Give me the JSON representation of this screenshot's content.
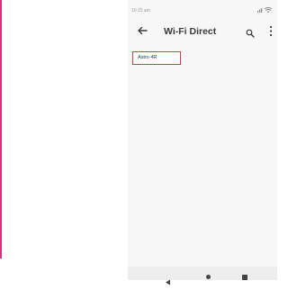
{
  "status_bar": {
    "time": "10:15 am"
  },
  "app_bar": {
    "title": "Wi-Fi Direct"
  },
  "devices": [
    {
      "name": "Astro 4R"
    }
  ],
  "colors": {
    "accent_border": "#e23a3a",
    "edge_rule": "#d8327a"
  },
  "icons": [
    "back-arrow-icon",
    "search-icon",
    "more-vert-icon",
    "signal-icon",
    "wifi-icon",
    "nav-back-icon",
    "nav-home-icon",
    "nav-recent-icon"
  ]
}
